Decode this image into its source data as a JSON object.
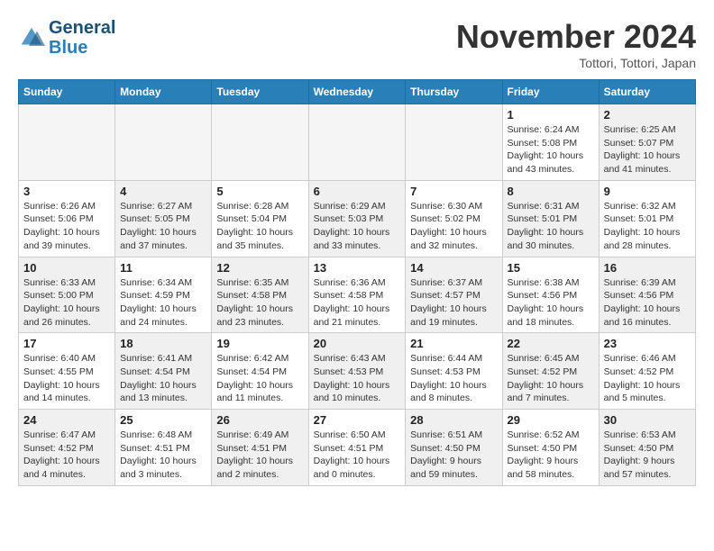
{
  "header": {
    "logo_line1": "General",
    "logo_line2": "Blue",
    "month": "November 2024",
    "location": "Tottori, Tottori, Japan"
  },
  "weekdays": [
    "Sunday",
    "Monday",
    "Tuesday",
    "Wednesday",
    "Thursday",
    "Friday",
    "Saturday"
  ],
  "weeks": [
    [
      {
        "day": "",
        "empty": true
      },
      {
        "day": "",
        "empty": true
      },
      {
        "day": "",
        "empty": true
      },
      {
        "day": "",
        "empty": true
      },
      {
        "day": "",
        "empty": true
      },
      {
        "day": "1",
        "info": "Sunrise: 6:24 AM\nSunset: 5:08 PM\nDaylight: 10 hours\nand 43 minutes."
      },
      {
        "day": "2",
        "info": "Sunrise: 6:25 AM\nSunset: 5:07 PM\nDaylight: 10 hours\nand 41 minutes.",
        "shaded": true
      }
    ],
    [
      {
        "day": "3",
        "info": "Sunrise: 6:26 AM\nSunset: 5:06 PM\nDaylight: 10 hours\nand 39 minutes."
      },
      {
        "day": "4",
        "info": "Sunrise: 6:27 AM\nSunset: 5:05 PM\nDaylight: 10 hours\nand 37 minutes.",
        "shaded": true
      },
      {
        "day": "5",
        "info": "Sunrise: 6:28 AM\nSunset: 5:04 PM\nDaylight: 10 hours\nand 35 minutes."
      },
      {
        "day": "6",
        "info": "Sunrise: 6:29 AM\nSunset: 5:03 PM\nDaylight: 10 hours\nand 33 minutes.",
        "shaded": true
      },
      {
        "day": "7",
        "info": "Sunrise: 6:30 AM\nSunset: 5:02 PM\nDaylight: 10 hours\nand 32 minutes."
      },
      {
        "day": "8",
        "info": "Sunrise: 6:31 AM\nSunset: 5:01 PM\nDaylight: 10 hours\nand 30 minutes.",
        "shaded": true
      },
      {
        "day": "9",
        "info": "Sunrise: 6:32 AM\nSunset: 5:01 PM\nDaylight: 10 hours\nand 28 minutes."
      }
    ],
    [
      {
        "day": "10",
        "info": "Sunrise: 6:33 AM\nSunset: 5:00 PM\nDaylight: 10 hours\nand 26 minutes.",
        "shaded": true
      },
      {
        "day": "11",
        "info": "Sunrise: 6:34 AM\nSunset: 4:59 PM\nDaylight: 10 hours\nand 24 minutes."
      },
      {
        "day": "12",
        "info": "Sunrise: 6:35 AM\nSunset: 4:58 PM\nDaylight: 10 hours\nand 23 minutes.",
        "shaded": true
      },
      {
        "day": "13",
        "info": "Sunrise: 6:36 AM\nSunset: 4:58 PM\nDaylight: 10 hours\nand 21 minutes."
      },
      {
        "day": "14",
        "info": "Sunrise: 6:37 AM\nSunset: 4:57 PM\nDaylight: 10 hours\nand 19 minutes.",
        "shaded": true
      },
      {
        "day": "15",
        "info": "Sunrise: 6:38 AM\nSunset: 4:56 PM\nDaylight: 10 hours\nand 18 minutes."
      },
      {
        "day": "16",
        "info": "Sunrise: 6:39 AM\nSunset: 4:56 PM\nDaylight: 10 hours\nand 16 minutes.",
        "shaded": true
      }
    ],
    [
      {
        "day": "17",
        "info": "Sunrise: 6:40 AM\nSunset: 4:55 PM\nDaylight: 10 hours\nand 14 minutes."
      },
      {
        "day": "18",
        "info": "Sunrise: 6:41 AM\nSunset: 4:54 PM\nDaylight: 10 hours\nand 13 minutes.",
        "shaded": true
      },
      {
        "day": "19",
        "info": "Sunrise: 6:42 AM\nSunset: 4:54 PM\nDaylight: 10 hours\nand 11 minutes."
      },
      {
        "day": "20",
        "info": "Sunrise: 6:43 AM\nSunset: 4:53 PM\nDaylight: 10 hours\nand 10 minutes.",
        "shaded": true
      },
      {
        "day": "21",
        "info": "Sunrise: 6:44 AM\nSunset: 4:53 PM\nDaylight: 10 hours\nand 8 minutes."
      },
      {
        "day": "22",
        "info": "Sunrise: 6:45 AM\nSunset: 4:52 PM\nDaylight: 10 hours\nand 7 minutes.",
        "shaded": true
      },
      {
        "day": "23",
        "info": "Sunrise: 6:46 AM\nSunset: 4:52 PM\nDaylight: 10 hours\nand 5 minutes."
      }
    ],
    [
      {
        "day": "24",
        "info": "Sunrise: 6:47 AM\nSunset: 4:52 PM\nDaylight: 10 hours\nand 4 minutes.",
        "shaded": true
      },
      {
        "day": "25",
        "info": "Sunrise: 6:48 AM\nSunset: 4:51 PM\nDaylight: 10 hours\nand 3 minutes."
      },
      {
        "day": "26",
        "info": "Sunrise: 6:49 AM\nSunset: 4:51 PM\nDaylight: 10 hours\nand 2 minutes.",
        "shaded": true
      },
      {
        "day": "27",
        "info": "Sunrise: 6:50 AM\nSunset: 4:51 PM\nDaylight: 10 hours\nand 0 minutes."
      },
      {
        "day": "28",
        "info": "Sunrise: 6:51 AM\nSunset: 4:50 PM\nDaylight: 9 hours\nand 59 minutes.",
        "shaded": true
      },
      {
        "day": "29",
        "info": "Sunrise: 6:52 AM\nSunset: 4:50 PM\nDaylight: 9 hours\nand 58 minutes."
      },
      {
        "day": "30",
        "info": "Sunrise: 6:53 AM\nSunset: 4:50 PM\nDaylight: 9 hours\nand 57 minutes.",
        "shaded": true
      }
    ]
  ]
}
